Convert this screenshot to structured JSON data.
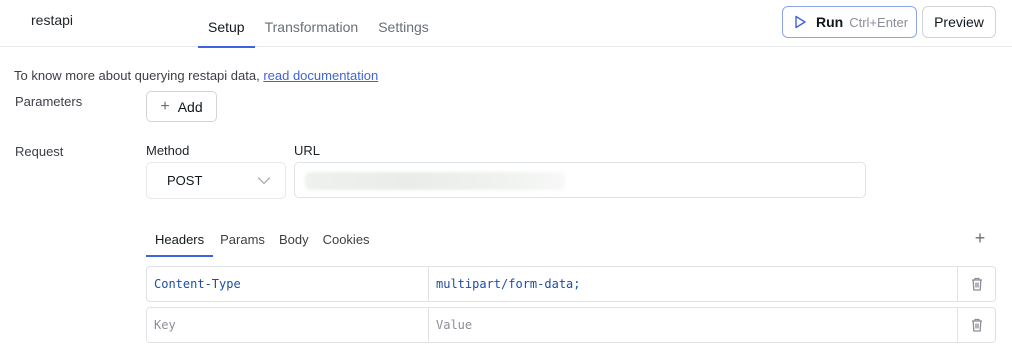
{
  "header": {
    "query_name": "restapi",
    "tabs": [
      {
        "label": "Setup",
        "active": true
      },
      {
        "label": "Transformation",
        "active": false
      },
      {
        "label": "Settings",
        "active": false
      }
    ],
    "run_label": "Run",
    "run_shortcut": "Ctrl+Enter",
    "preview_label": "Preview"
  },
  "doc": {
    "text": "To know more about querying restapi data, ",
    "link_text": "read documentation"
  },
  "parameters": {
    "label": "Parameters",
    "add_label": "Add"
  },
  "request": {
    "label": "Request",
    "method_label": "Method",
    "method_value": "POST",
    "url_label": "URL",
    "url_value": ""
  },
  "subtabs": [
    {
      "label": "Headers",
      "active": true
    },
    {
      "label": "Params",
      "active": false
    },
    {
      "label": "Body",
      "active": false
    },
    {
      "label": "Cookies",
      "active": false
    }
  ],
  "headers": [
    {
      "key": "Content-Type",
      "value": "multipart/form-data;"
    }
  ],
  "new_row": {
    "key_placeholder": "Key",
    "value_placeholder": "Value"
  },
  "colors": {
    "accent": "#3e63dd",
    "code_text": "#1c4ea8"
  }
}
